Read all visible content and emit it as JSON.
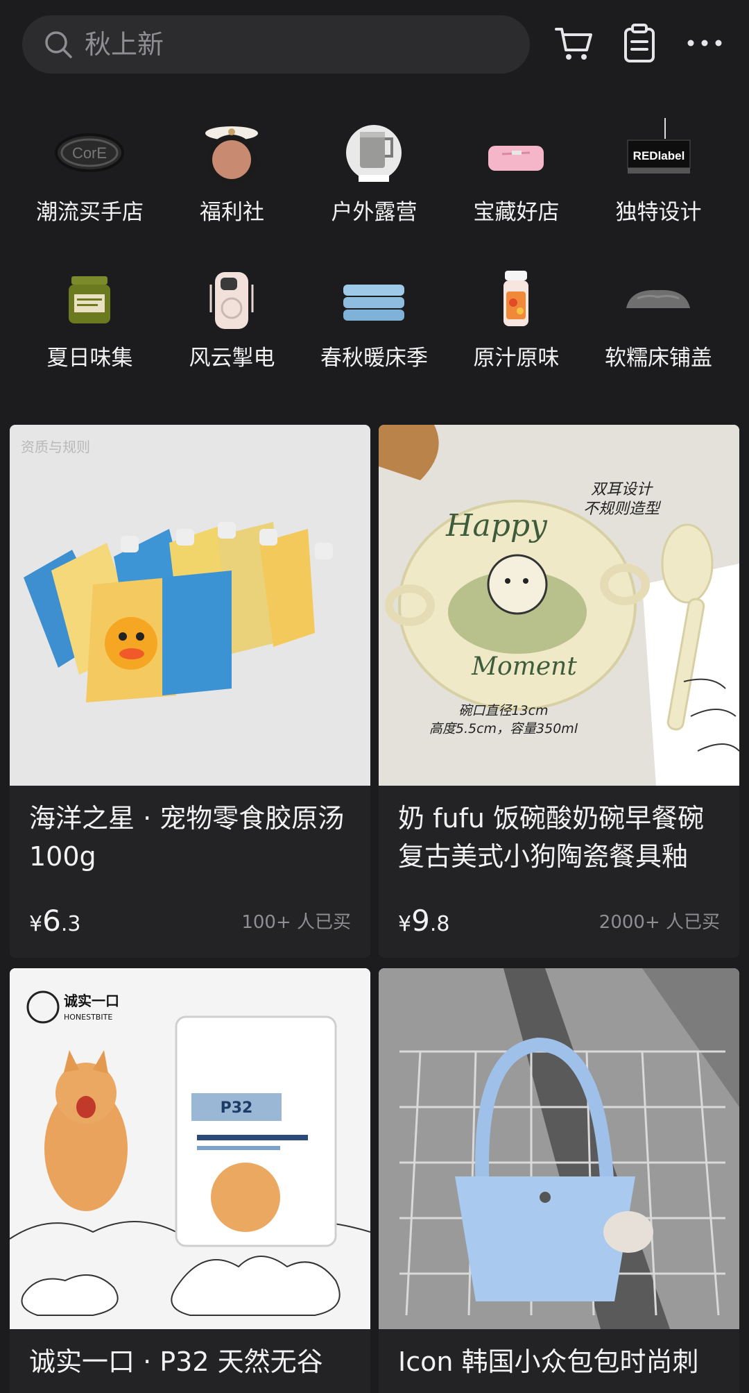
{
  "search": {
    "placeholder": "秋上新"
  },
  "header_icons": [
    "cart-icon",
    "clipboard-icon",
    "more-icon"
  ],
  "categories": [
    {
      "label": "潮流买手店",
      "icon": "core-logo"
    },
    {
      "label": "福利社",
      "icon": "compact-powder"
    },
    {
      "label": "户外露营",
      "icon": "camping-mug"
    },
    {
      "label": "宝藏好店",
      "icon": "pink-bag"
    },
    {
      "label": "独特设计",
      "icon": "redlabel-sign"
    },
    {
      "label": "夏日味集",
      "icon": "jar"
    },
    {
      "label": "风云掣电",
      "icon": "power-bank"
    },
    {
      "label": "春秋暖床季",
      "icon": "blanket-stack"
    },
    {
      "label": "原汁原味",
      "icon": "juicer"
    },
    {
      "label": "软糯床铺盖",
      "icon": "duvet"
    }
  ],
  "products": [
    {
      "title": "海洋之星 · 宠物零食胶原汤 100g",
      "currency": "¥",
      "price_int": "6",
      "price_dec": ".3",
      "sold": "100+ 人已买",
      "watermark": "资质与规则"
    },
    {
      "title": "奶 fufu 饭碗酸奶碗早餐碗复古美式小狗陶瓷餐具釉",
      "currency": "¥",
      "price_int": "9",
      "price_dec": ".8",
      "sold": "2000+ 人已买",
      "overlay_top": "双耳设计",
      "overlay_top2": "不规则造型",
      "overlay_bottom": "碗口直径13cm",
      "overlay_bottom2": "高度5.5cm，容量350ml",
      "bowl_text1": "Happy",
      "bowl_text2": "Moment"
    },
    {
      "title": "诚实一口 · P32 天然无谷",
      "brand_cn": "诚实一口",
      "brand_en": "HONESTBITE",
      "bag_label": "P32"
    },
    {
      "title": "Icon 韩国小众包包时尚刺"
    }
  ],
  "colors": {
    "background": "#1c1c1e",
    "card": "#232325",
    "muted": "#8e8e93"
  }
}
